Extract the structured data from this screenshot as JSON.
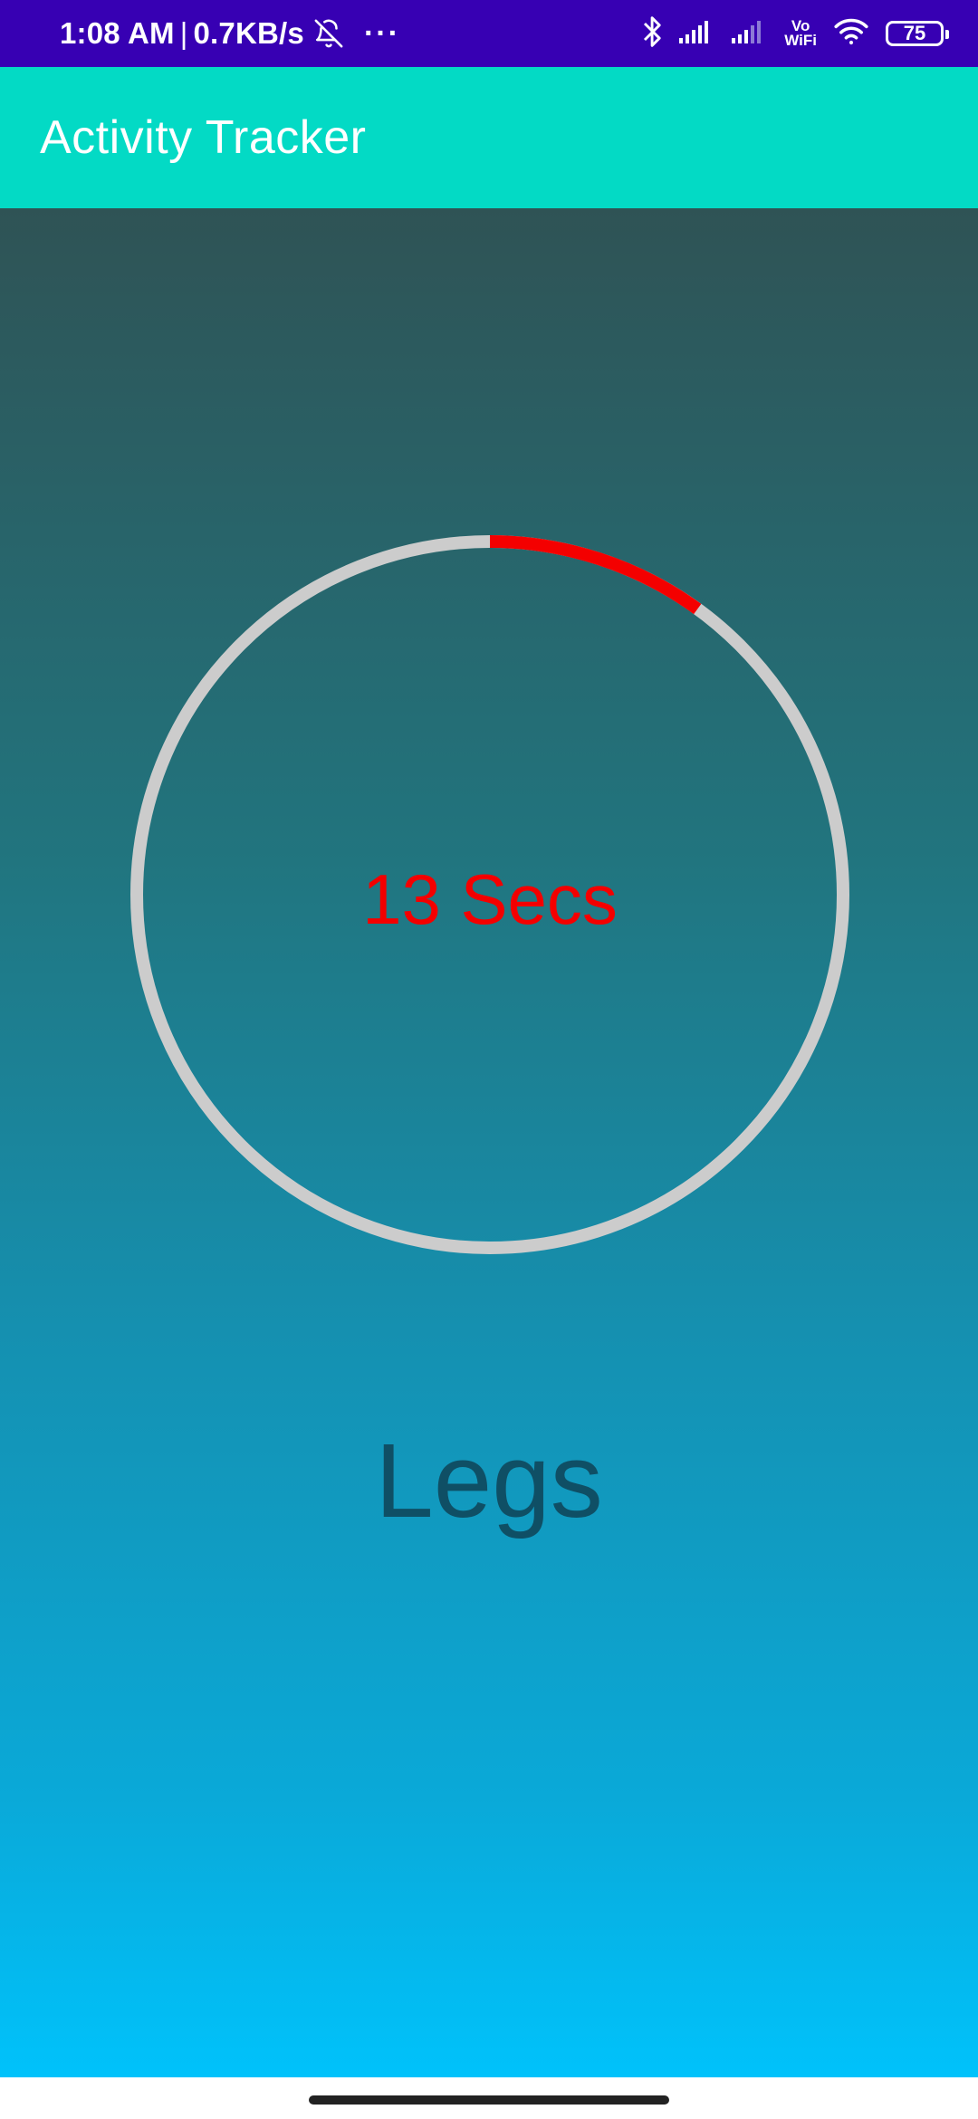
{
  "status_bar": {
    "time": "1:08 AM",
    "separator": "|",
    "net_speed": "0.7KB/s",
    "overflow": "···",
    "vo_label": "Vo",
    "wifi_label": "WiFi",
    "battery": "75",
    "icons": [
      "bell-off-icon",
      "bluetooth-icon",
      "signal-icon",
      "signal-icon",
      "wifi-icon",
      "battery-icon"
    ]
  },
  "app_bar": {
    "title": "Activity Tracker",
    "color": "#03dac5"
  },
  "timer": {
    "label": "13 Secs",
    "progress_fraction": 0.1,
    "track_color": "#cccccc",
    "progress_color": "#f40000"
  },
  "exercise": {
    "name": "Legs"
  },
  "colors": {
    "status_bar": "#3700b3",
    "gradient_top": "#2f5355",
    "gradient_bottom": "#00c2fb",
    "exercise_text": "#0f4f65"
  }
}
